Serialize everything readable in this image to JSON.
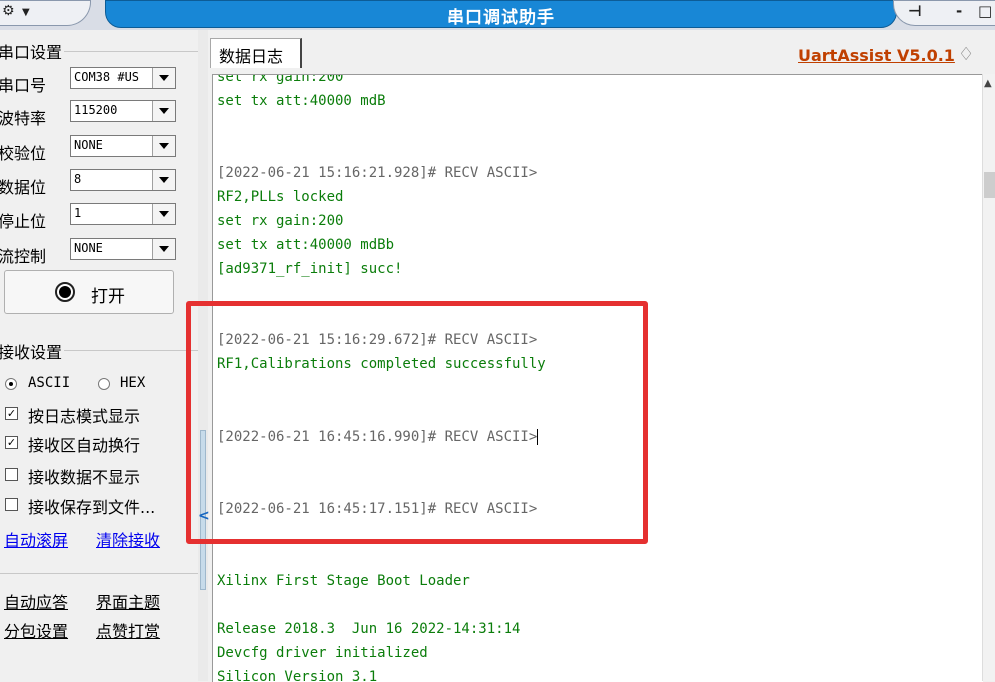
{
  "window": {
    "title": "串口调试助手",
    "sys_menu_icon": "⚙",
    "sys_menu_arrow": "▼",
    "pin": "⊣",
    "minimize": "-",
    "maximize": "□"
  },
  "serial_settings": {
    "group_title": "串口设置",
    "fields": [
      {
        "label": "串口号",
        "value": "COM38 #US"
      },
      {
        "label": "波特率",
        "value": "115200"
      },
      {
        "label": "校验位",
        "value": "NONE"
      },
      {
        "label": "数据位",
        "value": "8"
      },
      {
        "label": "停止位",
        "value": "1"
      },
      {
        "label": "流控制",
        "value": "NONE"
      }
    ],
    "open_button": "打开"
  },
  "receive_settings": {
    "group_title": "接收设置",
    "radio_ascii": "ASCII",
    "radio_hex": "HEX",
    "selected_mode": "ASCII",
    "options": [
      {
        "label": "按日志模式显示",
        "checked": true
      },
      {
        "label": "接收区自动换行",
        "checked": true
      },
      {
        "label": "接收数据不显示",
        "checked": false
      },
      {
        "label": "接收保存到文件...",
        "checked": false
      }
    ],
    "link_autoscroll": "自动滚屏",
    "link_clear": "清除接收"
  },
  "extra_links": {
    "auto_reply": "自动应答",
    "theme": "界面主题",
    "packet_settings": "分包设置",
    "reward": "点赞打赏"
  },
  "tabs": {
    "log_tab": "数据日志",
    "brand": "UartAssist V5.0.1",
    "gem_icon": "♢"
  },
  "log_lines": [
    {
      "text": "set rx gain:200",
      "color": "green"
    },
    {
      "text": "set tx att:40000 mdB",
      "color": "green"
    },
    {
      "text": "[2022-06-21 15:16:21.928]# RECV ASCII>",
      "color": "gray"
    },
    {
      "text": "RF2,PLLs locked",
      "color": "green"
    },
    {
      "text": "set rx gain:200",
      "color": "green"
    },
    {
      "text": "set tx att:40000 mdBb",
      "color": "green"
    },
    {
      "text": "[ad9371_rf_init] succ!",
      "color": "green"
    },
    {
      "text": "[2022-06-21 15:16:29.672]# RECV ASCII>",
      "color": "gray"
    },
    {
      "text": "RF1,Calibrations completed successfully",
      "color": "green"
    },
    {
      "text": "[2022-06-21 16:45:16.990]# RECV ASCII>",
      "color": "gray"
    },
    {
      "text": "[2022-06-21 16:45:17.151]# RECV ASCII>",
      "color": "gray"
    },
    {
      "text": "Xilinx First Stage Boot Loader",
      "color": "green"
    },
    {
      "text": "Release 2018.3  Jun 16 2022-14:31:14",
      "color": "green"
    },
    {
      "text": "Devcfg driver initialized",
      "color": "green"
    },
    {
      "text": "Silicon Version 3.1",
      "color": "green"
    }
  ],
  "colors": {
    "title_blue": "#1887d6",
    "log_green": "#0b7d0b",
    "highlight_red": "#e53030",
    "brand_orange": "#c04000"
  }
}
